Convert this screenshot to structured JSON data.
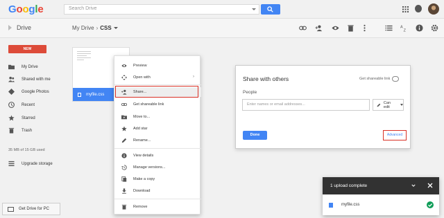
{
  "header": {
    "logo_letters": [
      {
        "ch": "G",
        "color": "#4285f4"
      },
      {
        "ch": "o",
        "color": "#ea4335"
      },
      {
        "ch": "o",
        "color": "#fbbc05"
      },
      {
        "ch": "g",
        "color": "#4285f4"
      },
      {
        "ch": "l",
        "color": "#34a853"
      },
      {
        "ch": "e",
        "color": "#ea4335"
      }
    ],
    "search_placeholder": "Search Drive"
  },
  "navbar": {
    "app_title": "Drive",
    "breadcrumb_root": "My Drive",
    "breadcrumb_current": "CSS",
    "toolbar_icons": [
      "link-icon",
      "add-person-icon",
      "eye-icon",
      "trash-icon",
      "more-vert-icon",
      "list-view-icon",
      "sort-az-icon",
      "info-icon",
      "settings-icon"
    ]
  },
  "sidebar": {
    "new_label": "NEW",
    "items": [
      {
        "label": "My Drive",
        "icon": "my-drive-icon"
      },
      {
        "label": "Shared with me",
        "icon": "shared-icon"
      },
      {
        "label": "Google Photos",
        "icon": "photos-icon"
      },
      {
        "label": "Recent",
        "icon": "clock-icon"
      },
      {
        "label": "Starred",
        "icon": "star-icon"
      },
      {
        "label": "Trash",
        "icon": "trash-icon"
      }
    ],
    "storage": "35 MB of 15 GB used",
    "upgrade": "Upgrade storage",
    "get_drive": "Get Drive for PC"
  },
  "file": {
    "name": "myfile.css"
  },
  "context_menu": {
    "items": [
      {
        "label": "Preview",
        "icon": "eye-icon"
      },
      {
        "label": "Open with",
        "icon": "move-arrows-icon",
        "submenu": "›"
      },
      {
        "label": "Share...",
        "icon": "add-person-icon"
      },
      {
        "label": "Get shareable link",
        "icon": "link-icon"
      },
      {
        "label": "Move to...",
        "icon": "folder-move-icon"
      },
      {
        "label": "Add star",
        "icon": "star-icon"
      },
      {
        "label": "Rename...",
        "icon": "pencil-icon"
      },
      {
        "label": "View details",
        "icon": "info-icon"
      },
      {
        "label": "Manage versions...",
        "icon": "history-icon"
      },
      {
        "label": "Make a copy",
        "icon": "copy-icon"
      },
      {
        "label": "Download",
        "icon": "download-icon"
      },
      {
        "label": "Remove",
        "icon": "trash-icon"
      }
    ]
  },
  "share_dialog": {
    "title": "Share with others",
    "shareable_link": "Get shareable link",
    "people_label": "People",
    "input_placeholder": "Enter names or email addresses...",
    "permission": "Can edit",
    "done": "Done",
    "advanced": "Advanced"
  },
  "upload_panel": {
    "title": "1 upload complete",
    "file_name": "myfile.css"
  }
}
